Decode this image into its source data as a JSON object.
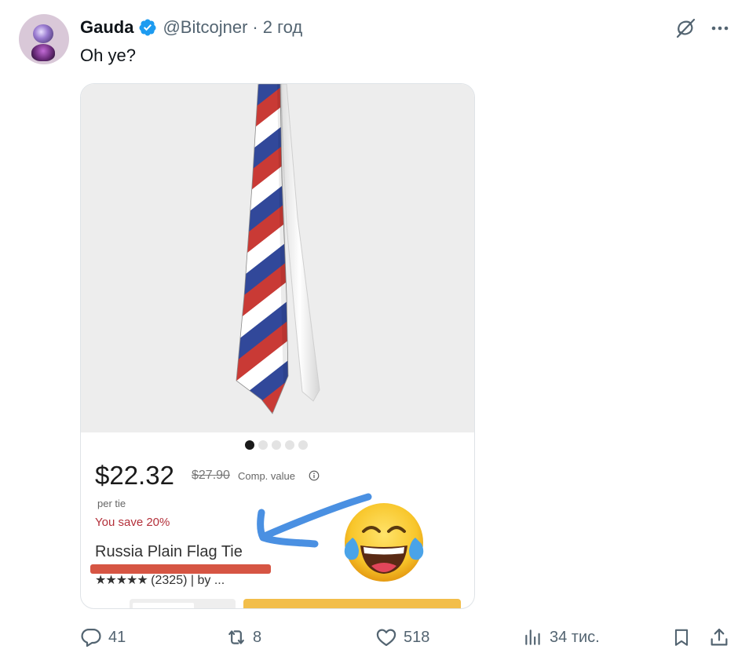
{
  "author": {
    "name": "Gauda",
    "handle": "@Bitcojner",
    "separator": "·",
    "time": "2 год"
  },
  "tweet": {
    "text": "Oh ye?"
  },
  "media": {
    "carousel_dots": 5,
    "active_dot": 0,
    "price": "$22.32",
    "old_price": "$27.90",
    "comp_value": "Comp. value",
    "per_unit": "per tie",
    "you_save": "You save 20%",
    "product_name": "Russia Plain Flag Tie",
    "stars": "★★★★★",
    "rating_text": "(2325) | by ...",
    "emoji": "face-with-tears-of-joy"
  },
  "actions": {
    "replies": "41",
    "reposts": "8",
    "likes": "518",
    "views": "34 тис."
  },
  "colors": {
    "accent_verified": "#1d9bf0",
    "icon_grey": "#536471",
    "text": "#0f1419",
    "sale_red": "#b3303a",
    "arrow_blue": "#4a90e2",
    "button_yellow": "#f2be4a"
  }
}
